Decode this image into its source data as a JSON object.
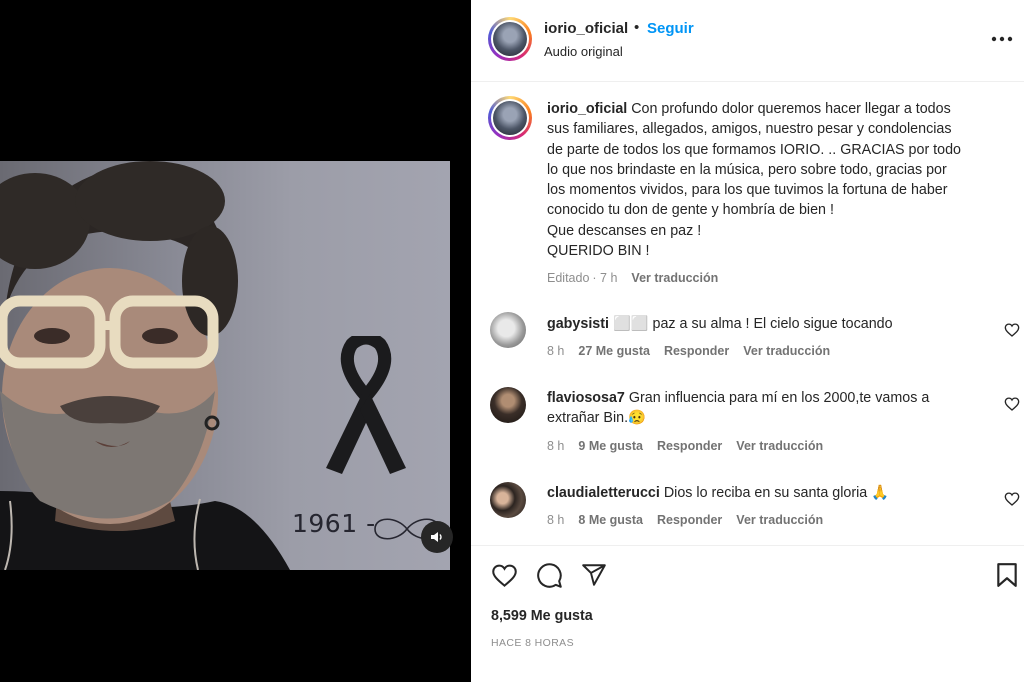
{
  "post": {
    "username": "iorio_oficial",
    "separator": "•",
    "follow_label": "Seguir",
    "audio_label": "Audio original",
    "more_icon": "more-horizontal-icon"
  },
  "media": {
    "years_text": "1961 -",
    "mute_icon": "speaker-icon"
  },
  "caption": {
    "username": "iorio_oficial",
    "lines": [
      " Con profundo dolor queremos hacer llegar a todos",
      "sus familiares, allegados, amigos, nuestro pesar y condolencias",
      "de parte de todos los que formamos IORIO. .. GRACIAS por todo",
      "lo que nos brindaste en la música, pero sobre todo, gracias por",
      "los momentos vividos, para los que tuvimos la fortuna de haber",
      "conocido tu don de gente y hombría de bien !",
      "Que descanses en paz !",
      "QUERIDO BIN !"
    ],
    "edited_label": "Editado",
    "edited_time": "· 7 h",
    "translate_label": "Ver traducción"
  },
  "comments": [
    {
      "username": "gabysisti",
      "text_lines": [
        " ⬜⬜ paz a su alma ! El cielo sigue tocando"
      ],
      "time": "8 h",
      "likes": "27 Me gusta",
      "reply_label": "Responder",
      "translate_label": "Ver traducción"
    },
    {
      "username": "flaviososa7",
      "text_lines": [
        " Gran influencia para mí en los 2000,te vamos a",
        "extrañar Bin.😥"
      ],
      "time": "8 h",
      "likes": "9 Me gusta",
      "reply_label": "Responder",
      "translate_label": "Ver traducción"
    },
    {
      "username": "claudialetterucci",
      "text_lines": [
        " Dios lo reciba en su santa gloria 🙏"
      ],
      "time": "8 h",
      "likes": "8 Me gusta",
      "reply_label": "Responder",
      "translate_label": "Ver traducción"
    }
  ],
  "actions": {
    "like_icon": "heart-icon",
    "comment_icon": "comment-icon",
    "share_icon": "share-icon",
    "save_icon": "bookmark-icon",
    "likes_count": "8,599 Me gusta",
    "timestamp": "HACE 8 HORAS"
  },
  "colors": {
    "link_blue": "#0095f6",
    "text_primary": "#262626",
    "text_secondary": "#8e8e8e"
  }
}
